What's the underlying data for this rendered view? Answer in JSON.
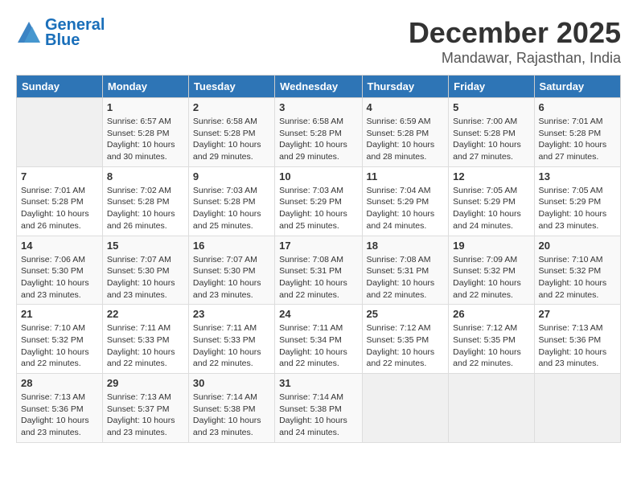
{
  "logo": {
    "line1": "General",
    "line2": "Blue"
  },
  "title": "December 2025",
  "location": "Mandawar, Rajasthan, India",
  "headers": [
    "Sunday",
    "Monday",
    "Tuesday",
    "Wednesday",
    "Thursday",
    "Friday",
    "Saturday"
  ],
  "weeks": [
    [
      {
        "day": "",
        "info": ""
      },
      {
        "day": "1",
        "info": "Sunrise: 6:57 AM\nSunset: 5:28 PM\nDaylight: 10 hours\nand 30 minutes."
      },
      {
        "day": "2",
        "info": "Sunrise: 6:58 AM\nSunset: 5:28 PM\nDaylight: 10 hours\nand 29 minutes."
      },
      {
        "day": "3",
        "info": "Sunrise: 6:58 AM\nSunset: 5:28 PM\nDaylight: 10 hours\nand 29 minutes."
      },
      {
        "day": "4",
        "info": "Sunrise: 6:59 AM\nSunset: 5:28 PM\nDaylight: 10 hours\nand 28 minutes."
      },
      {
        "day": "5",
        "info": "Sunrise: 7:00 AM\nSunset: 5:28 PM\nDaylight: 10 hours\nand 27 minutes."
      },
      {
        "day": "6",
        "info": "Sunrise: 7:01 AM\nSunset: 5:28 PM\nDaylight: 10 hours\nand 27 minutes."
      }
    ],
    [
      {
        "day": "7",
        "info": "Sunrise: 7:01 AM\nSunset: 5:28 PM\nDaylight: 10 hours\nand 26 minutes."
      },
      {
        "day": "8",
        "info": "Sunrise: 7:02 AM\nSunset: 5:28 PM\nDaylight: 10 hours\nand 26 minutes."
      },
      {
        "day": "9",
        "info": "Sunrise: 7:03 AM\nSunset: 5:28 PM\nDaylight: 10 hours\nand 25 minutes."
      },
      {
        "day": "10",
        "info": "Sunrise: 7:03 AM\nSunset: 5:29 PM\nDaylight: 10 hours\nand 25 minutes."
      },
      {
        "day": "11",
        "info": "Sunrise: 7:04 AM\nSunset: 5:29 PM\nDaylight: 10 hours\nand 24 minutes."
      },
      {
        "day": "12",
        "info": "Sunrise: 7:05 AM\nSunset: 5:29 PM\nDaylight: 10 hours\nand 24 minutes."
      },
      {
        "day": "13",
        "info": "Sunrise: 7:05 AM\nSunset: 5:29 PM\nDaylight: 10 hours\nand 23 minutes."
      }
    ],
    [
      {
        "day": "14",
        "info": "Sunrise: 7:06 AM\nSunset: 5:30 PM\nDaylight: 10 hours\nand 23 minutes."
      },
      {
        "day": "15",
        "info": "Sunrise: 7:07 AM\nSunset: 5:30 PM\nDaylight: 10 hours\nand 23 minutes."
      },
      {
        "day": "16",
        "info": "Sunrise: 7:07 AM\nSunset: 5:30 PM\nDaylight: 10 hours\nand 23 minutes."
      },
      {
        "day": "17",
        "info": "Sunrise: 7:08 AM\nSunset: 5:31 PM\nDaylight: 10 hours\nand 22 minutes."
      },
      {
        "day": "18",
        "info": "Sunrise: 7:08 AM\nSunset: 5:31 PM\nDaylight: 10 hours\nand 22 minutes."
      },
      {
        "day": "19",
        "info": "Sunrise: 7:09 AM\nSunset: 5:32 PM\nDaylight: 10 hours\nand 22 minutes."
      },
      {
        "day": "20",
        "info": "Sunrise: 7:10 AM\nSunset: 5:32 PM\nDaylight: 10 hours\nand 22 minutes."
      }
    ],
    [
      {
        "day": "21",
        "info": "Sunrise: 7:10 AM\nSunset: 5:32 PM\nDaylight: 10 hours\nand 22 minutes."
      },
      {
        "day": "22",
        "info": "Sunrise: 7:11 AM\nSunset: 5:33 PM\nDaylight: 10 hours\nand 22 minutes."
      },
      {
        "day": "23",
        "info": "Sunrise: 7:11 AM\nSunset: 5:33 PM\nDaylight: 10 hours\nand 22 minutes."
      },
      {
        "day": "24",
        "info": "Sunrise: 7:11 AM\nSunset: 5:34 PM\nDaylight: 10 hours\nand 22 minutes."
      },
      {
        "day": "25",
        "info": "Sunrise: 7:12 AM\nSunset: 5:35 PM\nDaylight: 10 hours\nand 22 minutes."
      },
      {
        "day": "26",
        "info": "Sunrise: 7:12 AM\nSunset: 5:35 PM\nDaylight: 10 hours\nand 22 minutes."
      },
      {
        "day": "27",
        "info": "Sunrise: 7:13 AM\nSunset: 5:36 PM\nDaylight: 10 hours\nand 23 minutes."
      }
    ],
    [
      {
        "day": "28",
        "info": "Sunrise: 7:13 AM\nSunset: 5:36 PM\nDaylight: 10 hours\nand 23 minutes."
      },
      {
        "day": "29",
        "info": "Sunrise: 7:13 AM\nSunset: 5:37 PM\nDaylight: 10 hours\nand 23 minutes."
      },
      {
        "day": "30",
        "info": "Sunrise: 7:14 AM\nSunset: 5:38 PM\nDaylight: 10 hours\nand 23 minutes."
      },
      {
        "day": "31",
        "info": "Sunrise: 7:14 AM\nSunset: 5:38 PM\nDaylight: 10 hours\nand 24 minutes."
      },
      {
        "day": "",
        "info": ""
      },
      {
        "day": "",
        "info": ""
      },
      {
        "day": "",
        "info": ""
      }
    ]
  ]
}
